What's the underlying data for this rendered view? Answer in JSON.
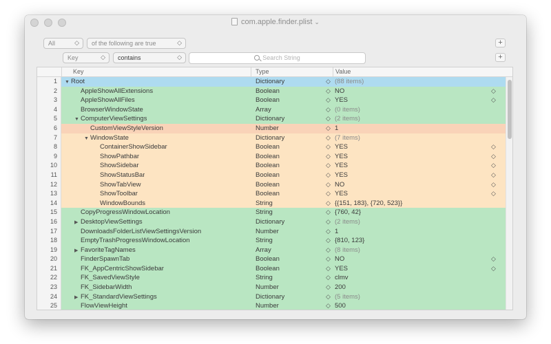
{
  "window": {
    "title": "com.apple.finder.plist"
  },
  "filter": {
    "match_mode": "All",
    "match_text": "of the following are true",
    "field": "Key",
    "operator": "contains",
    "search_placeholder": "Search String",
    "add_label": "+"
  },
  "columns": {
    "key": "Key",
    "type": "Type",
    "value": "Value"
  },
  "colors": {
    "root": "#aedbf0",
    "green": "#b9e6c2",
    "orange": "#f9d3b8",
    "peach": "#fde4c2"
  },
  "rows": [
    {
      "num": "1",
      "key": "Root",
      "indent": 0,
      "tri": "down",
      "type": "Dictionary",
      "value": "(88 items)",
      "color": "root",
      "muted": true,
      "stepper": false
    },
    {
      "num": "2",
      "key": "AppleShowAllExtensions",
      "indent": 1,
      "tri": "",
      "type": "Boolean",
      "value": "NO",
      "color": "green",
      "muted": false,
      "stepper": true
    },
    {
      "num": "3",
      "key": "AppleShowAllFiles",
      "indent": 1,
      "tri": "",
      "type": "Boolean",
      "value": "YES",
      "color": "green",
      "muted": false,
      "stepper": true
    },
    {
      "num": "4",
      "key": "BrowserWindowState",
      "indent": 1,
      "tri": "",
      "type": "Array",
      "value": "(0 items)",
      "color": "green",
      "muted": true,
      "stepper": false
    },
    {
      "num": "5",
      "key": "ComputerViewSettings",
      "indent": 1,
      "tri": "down",
      "type": "Dictionary",
      "value": "(2 items)",
      "color": "green",
      "muted": true,
      "stepper": false
    },
    {
      "num": "6",
      "key": "CustomViewStyleVersion",
      "indent": 2,
      "tri": "",
      "type": "Number",
      "value": "1",
      "color": "orange",
      "muted": false,
      "stepper": false
    },
    {
      "num": "7",
      "key": "WindowState",
      "indent": 2,
      "tri": "down",
      "type": "Dictionary",
      "value": "(7 items)",
      "color": "peach",
      "muted": true,
      "stepper": false
    },
    {
      "num": "8",
      "key": "ContainerShowSidebar",
      "indent": 3,
      "tri": "",
      "type": "Boolean",
      "value": "YES",
      "color": "peach",
      "muted": false,
      "stepper": true
    },
    {
      "num": "9",
      "key": "ShowPathbar",
      "indent": 3,
      "tri": "",
      "type": "Boolean",
      "value": "YES",
      "color": "peach",
      "muted": false,
      "stepper": true
    },
    {
      "num": "10",
      "key": "ShowSidebar",
      "indent": 3,
      "tri": "",
      "type": "Boolean",
      "value": "YES",
      "color": "peach",
      "muted": false,
      "stepper": true
    },
    {
      "num": "11",
      "key": "ShowStatusBar",
      "indent": 3,
      "tri": "",
      "type": "Boolean",
      "value": "YES",
      "color": "peach",
      "muted": false,
      "stepper": true
    },
    {
      "num": "12",
      "key": "ShowTabView",
      "indent": 3,
      "tri": "",
      "type": "Boolean",
      "value": "NO",
      "color": "peach",
      "muted": false,
      "stepper": true
    },
    {
      "num": "13",
      "key": "ShowToolbar",
      "indent": 3,
      "tri": "",
      "type": "Boolean",
      "value": "YES",
      "color": "peach",
      "muted": false,
      "stepper": true
    },
    {
      "num": "14",
      "key": "WindowBounds",
      "indent": 3,
      "tri": "",
      "type": "String",
      "value": "{{151, 183}, {720, 523}}",
      "color": "peach",
      "muted": false,
      "stepper": false
    },
    {
      "num": "15",
      "key": "CopyProgressWindowLocation",
      "indent": 1,
      "tri": "",
      "type": "String",
      "value": "{760, 42}",
      "color": "green",
      "muted": false,
      "stepper": false
    },
    {
      "num": "16",
      "key": "DesktopViewSettings",
      "indent": 1,
      "tri": "right",
      "type": "Dictionary",
      "value": "(2 items)",
      "color": "green",
      "muted": true,
      "stepper": false
    },
    {
      "num": "17",
      "key": "DownloadsFolderListViewSettingsVersion",
      "indent": 1,
      "tri": "",
      "type": "Number",
      "value": "1",
      "color": "green",
      "muted": false,
      "stepper": false
    },
    {
      "num": "18",
      "key": "EmptyTrashProgressWindowLocation",
      "indent": 1,
      "tri": "",
      "type": "String",
      "value": "{810, 123}",
      "color": "green",
      "muted": false,
      "stepper": false
    },
    {
      "num": "19",
      "key": "FavoriteTagNames",
      "indent": 1,
      "tri": "right",
      "type": "Array",
      "value": "(8 items)",
      "color": "green",
      "muted": true,
      "stepper": false
    },
    {
      "num": "20",
      "key": "FinderSpawnTab",
      "indent": 1,
      "tri": "",
      "type": "Boolean",
      "value": "NO",
      "color": "green",
      "muted": false,
      "stepper": true
    },
    {
      "num": "21",
      "key": "FK_AppCentricShowSidebar",
      "indent": 1,
      "tri": "",
      "type": "Boolean",
      "value": "YES",
      "color": "green",
      "muted": false,
      "stepper": true
    },
    {
      "num": "22",
      "key": "FK_SavedViewStyle",
      "indent": 1,
      "tri": "",
      "type": "String",
      "value": "clmv",
      "color": "green",
      "muted": false,
      "stepper": false
    },
    {
      "num": "23",
      "key": "FK_SidebarWidth",
      "indent": 1,
      "tri": "",
      "type": "Number",
      "value": "200",
      "color": "green",
      "muted": false,
      "stepper": false
    },
    {
      "num": "24",
      "key": "FK_StandardViewSettings",
      "indent": 1,
      "tri": "right",
      "type": "Dictionary",
      "value": "(5 items)",
      "color": "green",
      "muted": true,
      "stepper": false
    },
    {
      "num": "25",
      "key": "FlowViewHeight",
      "indent": 1,
      "tri": "",
      "type": "Number",
      "value": "500",
      "color": "green",
      "muted": false,
      "stepper": false
    }
  ]
}
